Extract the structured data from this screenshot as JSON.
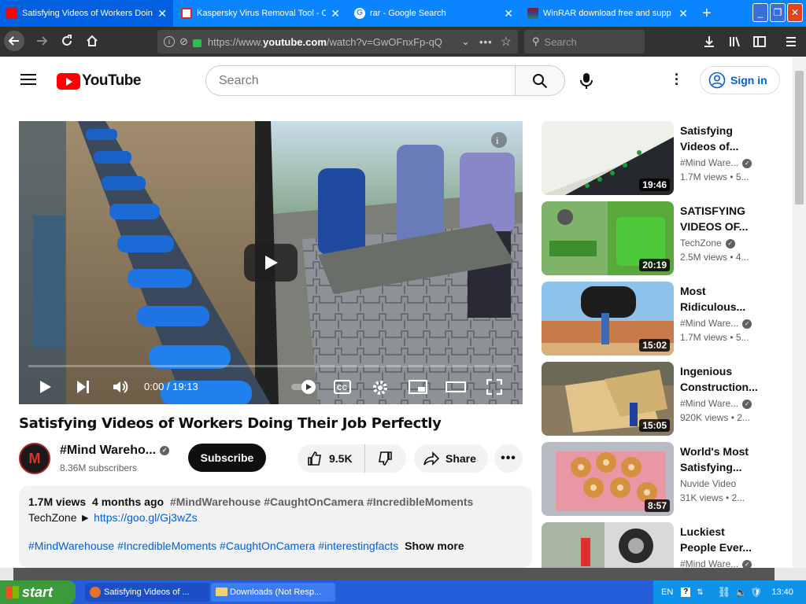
{
  "browser": {
    "tabs": [
      {
        "title": "Satisfying Videos of Workers Doing",
        "favicon_color": "#ff0000",
        "active": true
      },
      {
        "title": "Kaspersky Virus Removal Tool - C",
        "favicon_color": "#e8202a",
        "active": false
      },
      {
        "title": "rar - Google Search",
        "favicon_color": "#ffffff",
        "active": false
      },
      {
        "title": "WinRAR download free and supp",
        "favicon_color": "#8b1a1a",
        "active": false
      }
    ],
    "url": {
      "prefix": "https://www.",
      "domain": "youtube.com",
      "path": "/watch?v=GwOFnxFp-qQ"
    },
    "search_placeholder": "Search"
  },
  "youtube": {
    "logo_text": "YouTube",
    "search_placeholder": "Search",
    "signin_label": "Sign in"
  },
  "video": {
    "time": "0:00 / 19:13",
    "title": "Satisfying Videos of Workers Doing Their Job Perfectly",
    "channel": "#Mind Wareho...",
    "channel_initial": "M",
    "subscribers": "8.36M subscribers",
    "subscribe_label": "Subscribe",
    "likes": "9.5K",
    "share_label": "Share",
    "views": "1.7M views",
    "age": "4 months ago",
    "tags_line": "#MindWarehouse #CaughtOnCamera #IncredibleMoments",
    "credit_prefix": "TechZone ► ",
    "credit_link": "https://goo.gl/Gj3wZs",
    "hashtags": "#MindWarehouse #IncredibleMoments #CaughtOnCamera #interestingfacts",
    "show_more": "Show more"
  },
  "recommendations": [
    {
      "title1": "Satisfying",
      "title2": "Videos of...",
      "channel": "#Mind Ware...",
      "verified": true,
      "meta": "1.7M views  • 5...",
      "duration": "19:46"
    },
    {
      "title1": "SATISFYING",
      "title2": "VIDEOS OF...",
      "channel": "TechZone",
      "verified": true,
      "meta": "2.5M views  • 4...",
      "duration": "20:19"
    },
    {
      "title1": "Most",
      "title2": "Ridiculous...",
      "channel": "#Mind Ware...",
      "verified": true,
      "meta": "1.7M views  • 5...",
      "duration": "15:02"
    },
    {
      "title1": "Ingenious",
      "title2": "Construction...",
      "channel": "#Mind Ware...",
      "verified": true,
      "meta": "920K views  • 2...",
      "duration": "15:05"
    },
    {
      "title1": "World's Most",
      "title2": "Satisfying...",
      "channel": "Nuvide Video",
      "verified": false,
      "meta": "31K views  • 2...",
      "duration": "8:57"
    },
    {
      "title1": "Luckiest",
      "title2": "People Ever...",
      "channel": "#Mind Ware...",
      "verified": true,
      "meta": "",
      "duration": ""
    }
  ],
  "taskbar": {
    "start_label": "start",
    "tasks": [
      {
        "label": "Satisfying Videos of ...",
        "active": true
      },
      {
        "label": "Downloads (Not Resp...",
        "active": false
      }
    ],
    "lang": "EN",
    "clock": "13:40"
  }
}
